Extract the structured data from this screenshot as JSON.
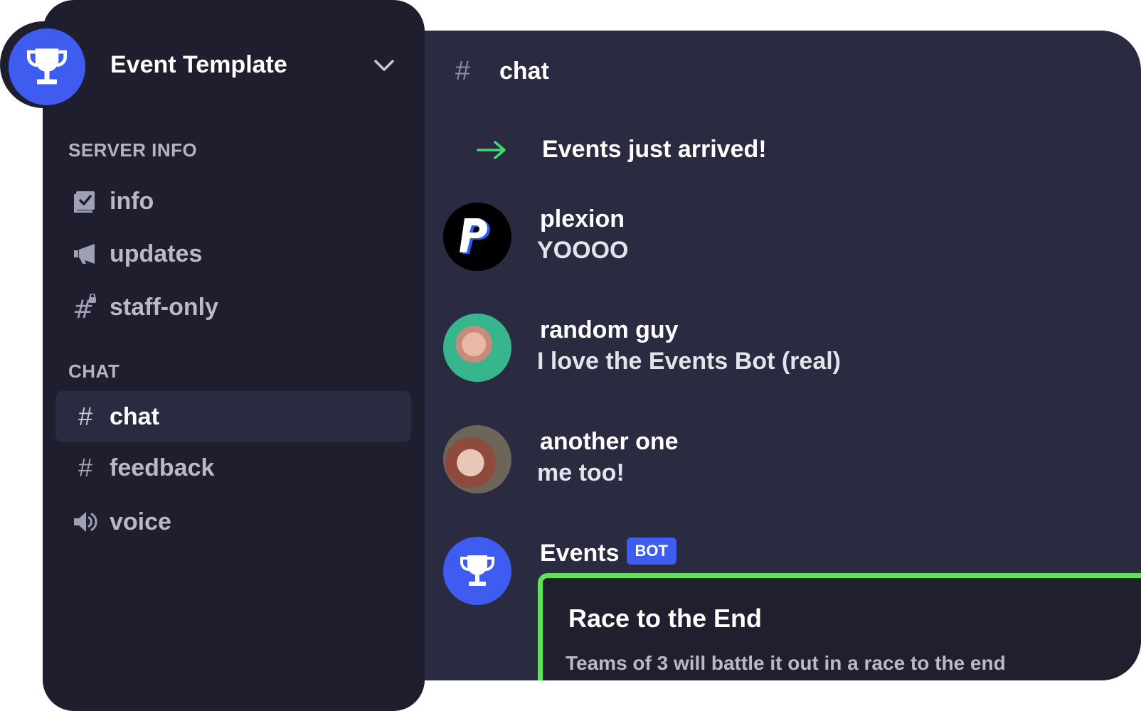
{
  "server": {
    "name": "Event Template",
    "icon": "trophy-icon",
    "accent": "#3e5cf0"
  },
  "sidebar": {
    "categories": [
      {
        "label": "SERVER INFO",
        "channels": [
          {
            "name": "info",
            "icon": "rules-checkbox-icon"
          },
          {
            "name": "updates",
            "icon": "megaphone-icon"
          },
          {
            "name": "staff-only",
            "icon": "locked-hash-icon"
          }
        ]
      },
      {
        "label": "CHAT",
        "channels": [
          {
            "name": "chat",
            "icon": "hash-icon",
            "active": true
          },
          {
            "name": "feedback",
            "icon": "hash-icon"
          },
          {
            "name": "voice",
            "icon": "speaker-icon"
          }
        ]
      }
    ]
  },
  "chat": {
    "channel_symbol": "#",
    "channel_name": "chat",
    "system_message": "Events just arrived!",
    "messages": [
      {
        "author": "plexion",
        "text": "YOOOO"
      },
      {
        "author": "random guy",
        "text": "I love the Events Bot (real)"
      },
      {
        "author": "another one",
        "text": "me too!"
      },
      {
        "author": "Events",
        "badge": "BOT",
        "text": ""
      }
    ],
    "embed": {
      "title": "Race to the End",
      "description": "Teams of 3 will battle it out in a race to the end",
      "border_color": "#5fe15a"
    }
  },
  "colors": {
    "sidebar_bg": "#1e1e2e",
    "chat_bg": "#2a2a41",
    "join_arrow": "#3ddc6e"
  }
}
